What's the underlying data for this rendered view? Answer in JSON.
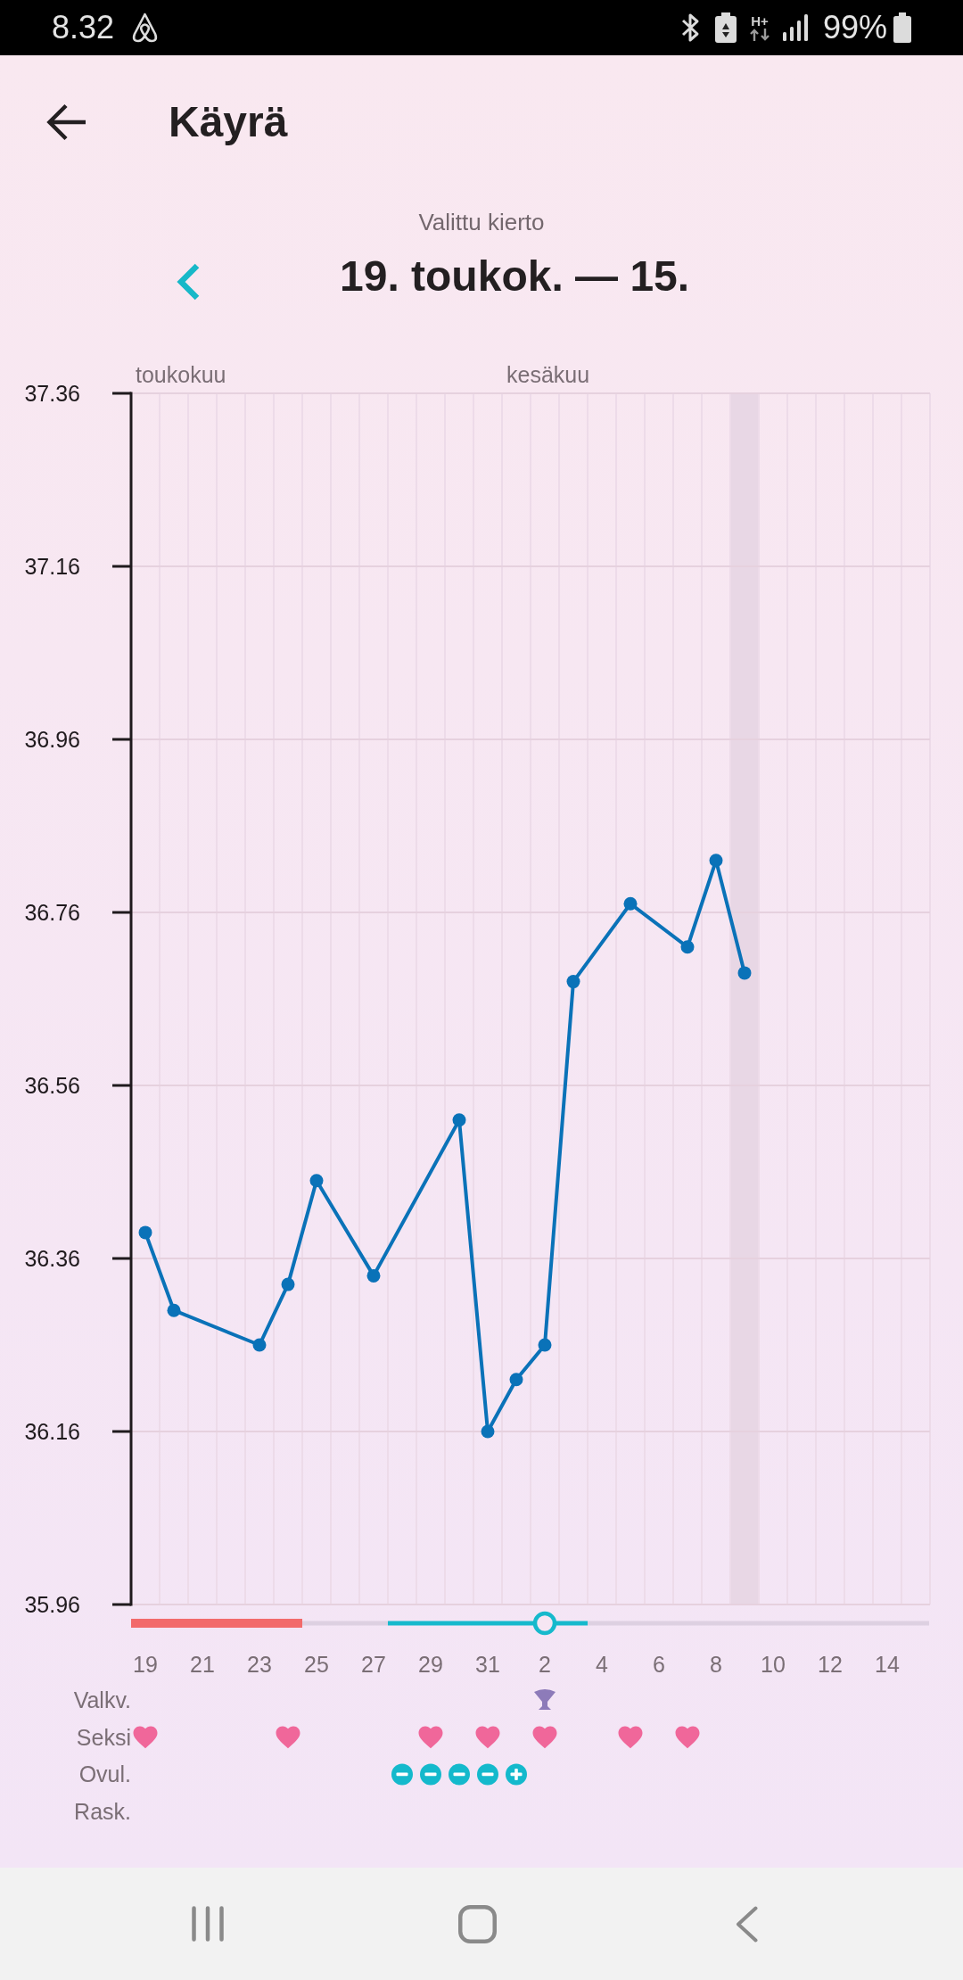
{
  "status_bar": {
    "time": "8.32",
    "network_type": "H+",
    "battery": "99%"
  },
  "header": {
    "title": "Käyrä"
  },
  "cycle_selector": {
    "caption": "Valittu kierto",
    "range": "19. toukok. — 15."
  },
  "chart": {
    "chart_data": {
      "type": "line",
      "categories": [
        "19",
        null,
        "21",
        null,
        "23",
        null,
        "25",
        null,
        "27",
        null,
        "29",
        null,
        "31",
        null,
        "2",
        null,
        "4",
        null,
        "6",
        null,
        "8",
        null,
        "10",
        null,
        "12",
        null,
        "14",
        null
      ],
      "values": [
        36.39,
        36.3,
        null,
        null,
        36.26,
        36.33,
        36.45,
        null,
        36.34,
        null,
        null,
        36.52,
        36.16,
        36.22,
        36.26,
        36.68,
        null,
        36.77,
        null,
        36.72,
        36.82,
        36.69,
        null,
        null,
        null,
        null,
        null,
        null
      ],
      "ylim": [
        35.96,
        37.36
      ],
      "yticks": [
        35.96,
        36.16,
        36.36,
        36.56,
        36.76,
        36.96,
        37.16,
        37.36
      ],
      "grid": true,
      "marker": true
    },
    "columns": [
      {
        "kind": "period",
        "month": "toukokuu"
      },
      {
        "kind": "period"
      },
      {
        "kind": "period"
      },
      {
        "kind": "period"
      },
      {
        "kind": "period"
      },
      {
        "kind": "period"
      },
      {
        "kind": "plain"
      },
      {
        "kind": "plain"
      },
      {
        "kind": "plain"
      },
      {
        "kind": "fertile"
      },
      {
        "kind": "fertile"
      },
      {
        "kind": "fertile"
      },
      {
        "kind": "fertile"
      },
      {
        "kind": "fertile",
        "month": "kesäkuu"
      },
      {
        "kind": "ovulation"
      },
      {
        "kind": "fertile"
      },
      {
        "kind": "plain"
      },
      {
        "kind": "plain"
      },
      {
        "kind": "plain"
      },
      {
        "kind": "plain"
      },
      {
        "kind": "plain"
      },
      {
        "kind": "plain",
        "today": true
      },
      {
        "kind": "plain"
      },
      {
        "kind": "plain"
      },
      {
        "kind": "plain"
      },
      {
        "kind": "plain"
      },
      {
        "kind": "plain"
      },
      {
        "kind": "plain"
      }
    ],
    "tracks": [
      {
        "label": "Valkv.",
        "days": [
          {
            "kind": "none"
          },
          {
            "kind": "none"
          },
          {
            "kind": "none"
          },
          {
            "kind": "none"
          },
          {
            "kind": "none"
          },
          {
            "kind": "none"
          },
          {
            "kind": "none"
          },
          {
            "kind": "none"
          },
          {
            "kind": "none"
          },
          {
            "kind": "none"
          },
          {
            "kind": "none"
          },
          {
            "kind": "none"
          },
          {
            "kind": "none"
          },
          {
            "kind": "none"
          },
          {
            "kind": "discharge"
          },
          {
            "kind": "none"
          },
          {
            "kind": "none"
          },
          {
            "kind": "none"
          },
          {
            "kind": "none"
          },
          {
            "kind": "none"
          },
          {
            "kind": "none"
          },
          {
            "kind": "none"
          },
          {
            "kind": "none"
          },
          {
            "kind": "none"
          },
          {
            "kind": "none"
          },
          {
            "kind": "none"
          },
          {
            "kind": "none"
          },
          {
            "kind": "none"
          }
        ]
      },
      {
        "label": "Seksi",
        "days": [
          {
            "kind": "heart"
          },
          {
            "kind": "none"
          },
          {
            "kind": "none"
          },
          {
            "kind": "none"
          },
          {
            "kind": "none"
          },
          {
            "kind": "heart"
          },
          {
            "kind": "none"
          },
          {
            "kind": "none"
          },
          {
            "kind": "none"
          },
          {
            "kind": "none"
          },
          {
            "kind": "heart"
          },
          {
            "kind": "none"
          },
          {
            "kind": "heart"
          },
          {
            "kind": "none"
          },
          {
            "kind": "heart"
          },
          {
            "kind": "none"
          },
          {
            "kind": "none"
          },
          {
            "kind": "heart"
          },
          {
            "kind": "none"
          },
          {
            "kind": "heart"
          },
          {
            "kind": "none"
          },
          {
            "kind": "none"
          },
          {
            "kind": "none"
          },
          {
            "kind": "none"
          },
          {
            "kind": "none"
          },
          {
            "kind": "none"
          },
          {
            "kind": "none"
          },
          {
            "kind": "none"
          }
        ]
      },
      {
        "label": "Ovul.",
        "days": [
          {
            "kind": "none"
          },
          {
            "kind": "none"
          },
          {
            "kind": "none"
          },
          {
            "kind": "none"
          },
          {
            "kind": "none"
          },
          {
            "kind": "none"
          },
          {
            "kind": "none"
          },
          {
            "kind": "none"
          },
          {
            "kind": "none"
          },
          {
            "kind": "negative"
          },
          {
            "kind": "negative"
          },
          {
            "kind": "negative"
          },
          {
            "kind": "negative"
          },
          {
            "kind": "positive"
          },
          {
            "kind": "none"
          },
          {
            "kind": "none"
          },
          {
            "kind": "none"
          },
          {
            "kind": "none"
          },
          {
            "kind": "none"
          },
          {
            "kind": "none"
          },
          {
            "kind": "none"
          },
          {
            "kind": "none"
          },
          {
            "kind": "none"
          },
          {
            "kind": "none"
          },
          {
            "kind": "none"
          },
          {
            "kind": "none"
          },
          {
            "kind": "none"
          },
          {
            "kind": "none"
          }
        ]
      },
      {
        "label": "Rask."
      }
    ]
  }
}
